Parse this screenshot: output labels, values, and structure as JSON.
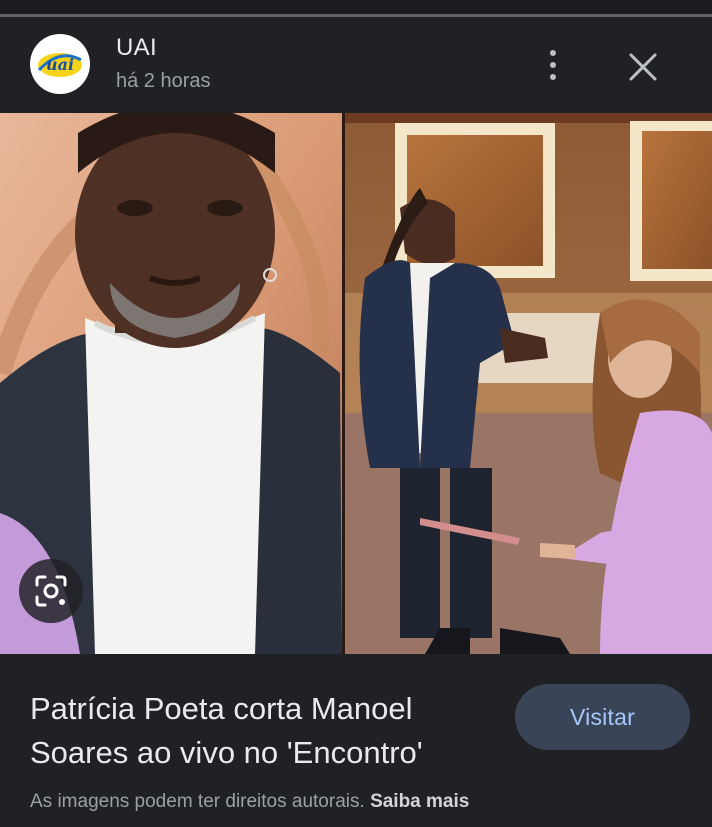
{
  "header": {
    "source_name": "UAI",
    "logo_text": "uai",
    "timestamp": "há 2 horas",
    "more_icon": "more-vert-icon",
    "close_icon": "close-icon"
  },
  "image": {
    "lens_icon": "lens-search-icon"
  },
  "caption": {
    "title": "Patrícia Poeta corta Manoel Soares ao vivo no 'Encontro'",
    "visit_label": "Visitar",
    "copyright_text": "As imagens podem ter direitos autorais.",
    "learn_more_label": "Saiba mais"
  },
  "colors": {
    "background": "#202124",
    "button_bg": "#394457",
    "button_text": "#a8c7fa",
    "muted_text": "#9aa0a6"
  }
}
